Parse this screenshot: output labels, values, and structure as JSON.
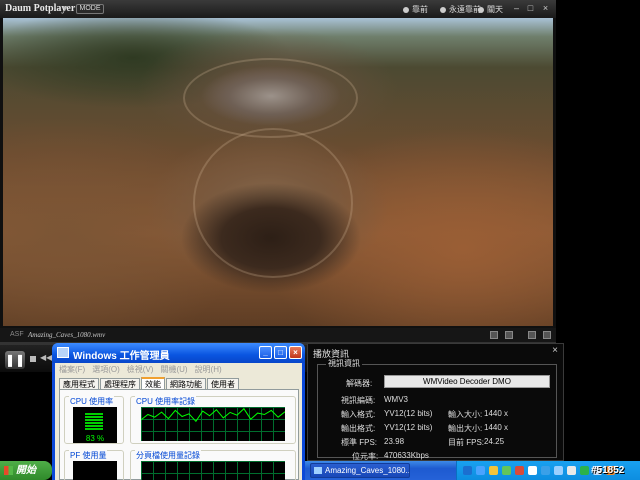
{
  "player": {
    "app_title": "Daum Potplayer",
    "mode_label": "MODE",
    "options": [
      "靠前",
      "永遠靠前",
      "關天"
    ],
    "format": "ASF",
    "filename": "Amazing_Caves_1080.wmv",
    "play_icon": "pause-icon"
  },
  "task_manager": {
    "title": "Windows 工作管理員",
    "menu": [
      "檔案(F)",
      "選項(O)",
      "檢視(V)",
      "關機(U)",
      "說明(H)"
    ],
    "tabs": [
      "應用程式",
      "處理程序",
      "效能",
      "網路功能",
      "使用者"
    ],
    "active_tab": "效能",
    "cpu_usage_label": "CPU 使用率",
    "cpu_percent": "83 %",
    "cpu_history_label": "CPU 使用率記錄",
    "pf_label": "PF 使用量",
    "pf_history_label": "分頁檔使用量記錄",
    "cpu_history": [
      0.62,
      0.78,
      0.7,
      0.85,
      0.66,
      0.9,
      0.72,
      0.8,
      0.58,
      0.88,
      0.74,
      0.92,
      0.68,
      0.84,
      0.76,
      0.95,
      0.64,
      0.82,
      0.78,
      0.9,
      0.7,
      0.86
    ]
  },
  "playback_info": {
    "title": "播放資訊",
    "video_group": "視訊資訊",
    "decoder_label": "解碼器:",
    "decoder_value": "WMVideo Decoder DMO",
    "codec_label": "視訊編碼:",
    "codec_value": "WMV3",
    "input_format_label": "輸入格式:",
    "input_format_value": "YV12(12 bits)",
    "input_size_label": "輸入大小:",
    "input_size_value": "1440 x",
    "output_format_label": "輸出格式:",
    "output_format_value": "YV12(12 bits)",
    "output_size_label": "輸出大小:",
    "output_size_value": "1440 x",
    "std_fps_label": "標準 FPS:",
    "std_fps_value": "23.98",
    "cur_fps_label": "目前 FPS:",
    "cur_fps_value": "24.25",
    "bitrate_label": "位元率:",
    "bitrate_value": "470633Kbps"
  },
  "taskbar": {
    "start_label": "開始",
    "task_item": "Amazing_Caves_1080...",
    "watermark": "#51852"
  }
}
